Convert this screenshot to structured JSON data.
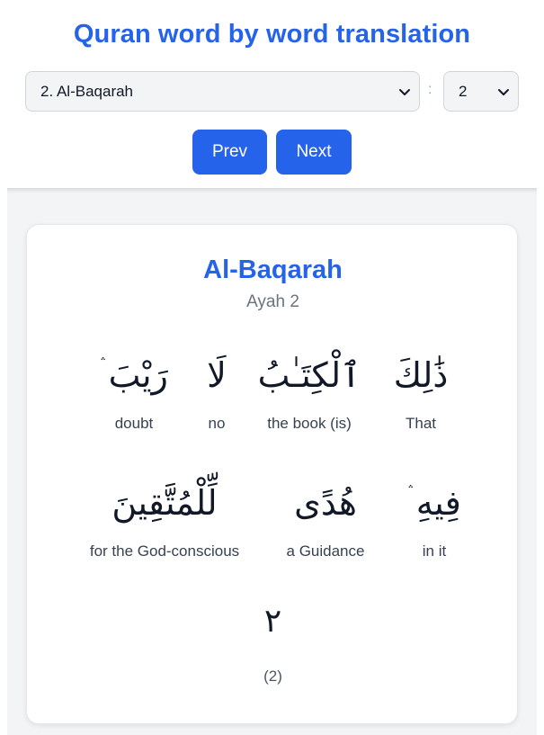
{
  "header": {
    "title": "Quran word by word translation",
    "surah_select_value": "2. Al-Baqarah",
    "separator": ":",
    "ayah_select_value": "2",
    "prev_label": "Prev",
    "next_label": "Next"
  },
  "card": {
    "surah_name": "Al-Baqarah",
    "ayah_label": "Ayah 2",
    "words": [
      {
        "arabic": "ذَٰلِكَ",
        "translation": "That"
      },
      {
        "arabic": "ٱلْكِتَـٰبُ",
        "translation": "the book (is)"
      },
      {
        "arabic": "لَا",
        "translation": "no"
      },
      {
        "arabic": "رَيْبَ ۛ",
        "translation": "doubt"
      },
      {
        "arabic": "فِيهِ ۛ",
        "translation": "in it"
      },
      {
        "arabic": "هُدًى",
        "translation": "a Guidance"
      },
      {
        "arabic": "لِّلْمُتَّقِينَ",
        "translation": "for the God-conscious"
      }
    ],
    "ayah_number_arabic": "٢",
    "ayah_number_latin": "(2)"
  },
  "colors": {
    "accent": "#2563eb",
    "background": "#f3f4f6",
    "card": "#ffffff"
  },
  "icons": {
    "select_chevron": "chevron-down-icon"
  }
}
